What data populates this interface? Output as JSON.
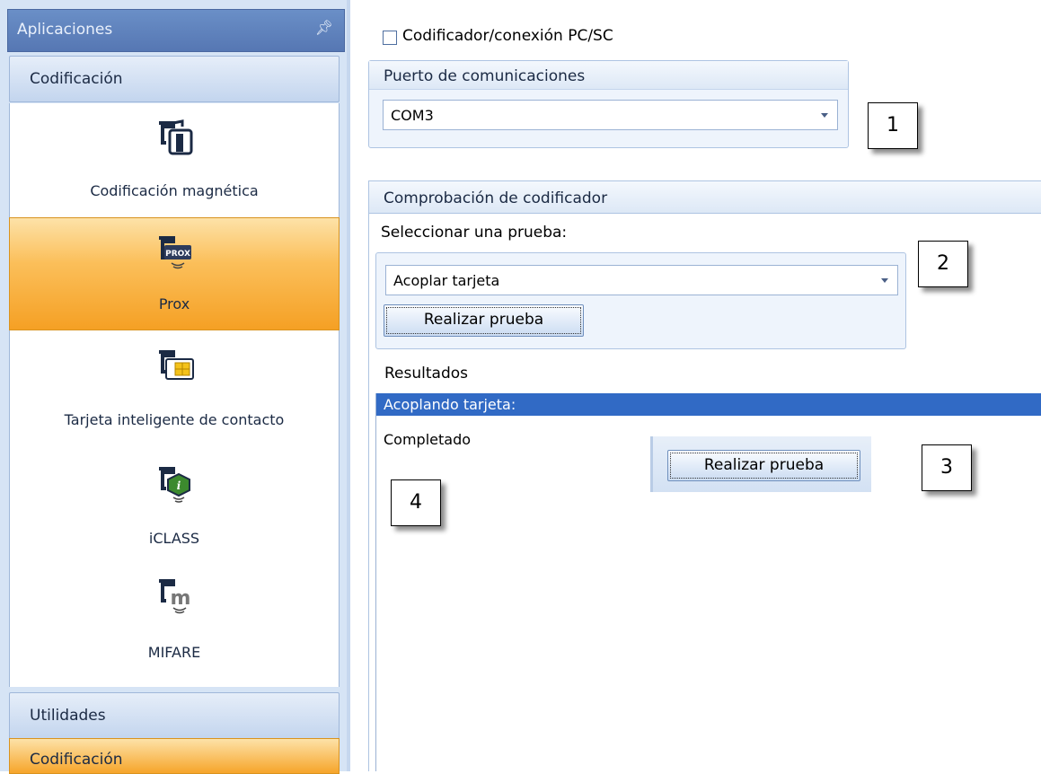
{
  "sidebar": {
    "header_title": "Aplicaciones",
    "pin_icon": "pin-icon",
    "group_label": "Codificación",
    "items": [
      {
        "label": "Codificación magnética",
        "icon": "magnetic-card-icon",
        "active": false
      },
      {
        "label": "Prox",
        "icon": "prox-card-icon",
        "active": true
      },
      {
        "label": "Tarjeta inteligente de contacto",
        "icon": "smart-card-icon",
        "active": false
      },
      {
        "label": "iCLASS",
        "icon": "iclass-card-icon",
        "active": false
      },
      {
        "label": "MIFARE",
        "icon": "mifare-card-icon",
        "active": false
      }
    ],
    "utilities_label": "Utilidades",
    "bottom_group_label": "Codificación"
  },
  "main": {
    "pcsc_checkbox_label": "Codificador/conexión PC/SC",
    "pcsc_checked": false,
    "port_panel_title": "Puerto de comunicaciones",
    "port_value": "COM3",
    "test_section_title": "Comprobación de codificador",
    "select_test_label": "Seleccionar una prueba:",
    "test_value": "Acoplar tarjeta",
    "run_test_label": "Realizar prueba",
    "results_label": "Resultados",
    "results": [
      "Acoplando tarjeta:",
      "Completado"
    ],
    "run_test_label_2": "Realizar prueba"
  },
  "callouts": [
    "1",
    "2",
    "3",
    "4"
  ],
  "colors": {
    "accent_orange": "#f5a024",
    "selection_blue": "#316ac5",
    "panel_blue": "#eef4fc"
  }
}
